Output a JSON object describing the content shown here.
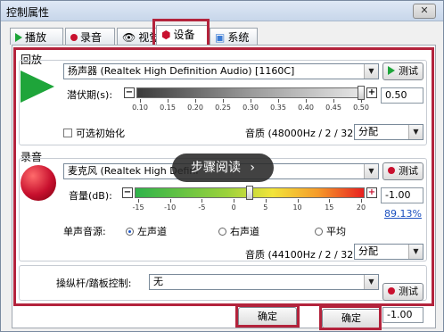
{
  "window": {
    "title": "控制属性",
    "close_label": "✕"
  },
  "tabs": [
    {
      "label": "播放",
      "icon": "play-icon"
    },
    {
      "label": "录音",
      "icon": "record-icon"
    },
    {
      "label": "视觉",
      "icon": "eye-icon"
    },
    {
      "label": "设备",
      "icon": "device-icon",
      "active": true
    },
    {
      "label": "系统",
      "icon": "system-icon"
    }
  ],
  "playback": {
    "section_label": "回放",
    "device_value": "扬声器 (Realtek High Definition Audio) [1160C]",
    "test_label": "测试",
    "latency_label": "潜伏期(s):",
    "latency_ticks": [
      "0.10",
      "0.15",
      "0.20",
      "0.25",
      "0.30",
      "0.35",
      "0.40",
      "0.45",
      "0.50"
    ],
    "latency_value": "0.50",
    "latency_level": 1.0,
    "optional_init_label": "可选初始化",
    "quality_label": "音质 (48000Hz / 2 / 32):",
    "quality_value": "分配"
  },
  "recording": {
    "section_label": "录音",
    "device_value": "麦克风 (Realtek High Defini",
    "test_label": "测试",
    "volume_label": "音量(dB):",
    "volume_ticks": [
      "-15",
      "-10",
      "-5",
      "0",
      "5",
      "10",
      "15",
      "20"
    ],
    "volume_value": "-1.00",
    "volume_percent": "89.13%",
    "volume_level": 0.5,
    "mono_source_label": "单声音源:",
    "mono_options": [
      {
        "label": "左声道",
        "selected": true
      },
      {
        "label": "右声道",
        "selected": false
      },
      {
        "label": "平均",
        "selected": false
      }
    ],
    "quality_label": "音质 (44100Hz / 2 / 32):",
    "quality_value": "分配"
  },
  "joystick": {
    "label": "操纵杆/踏板控制:",
    "value": "无",
    "test_label": "测试",
    "side_value": "-1.00"
  },
  "overlay": {
    "text": "步骤阅读",
    "chevron": "›"
  },
  "footer": {
    "ok_label": "确定",
    "ok2_label": "确定"
  }
}
